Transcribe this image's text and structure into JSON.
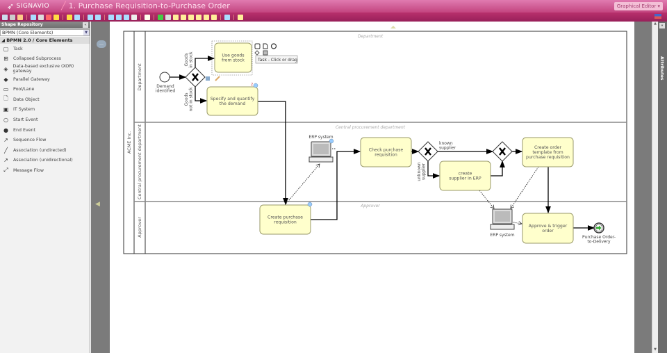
{
  "app": {
    "brand": "SIGNAVIO",
    "document_title": "1. Purchase Requisition-to-Purchase Order",
    "editor_mode": "Graphical Editor"
  },
  "toolbar": {
    "icons": [
      "save-icon",
      "print-icon",
      "cut-icon",
      "copy-icon",
      "paste-icon",
      "delete-icon",
      "undo-icon",
      "redo-icon",
      "align-icon",
      "layout-icon",
      "zoom-in-icon",
      "zoom-out-icon",
      "zoom-fit-icon",
      "zoom-page-icon",
      "text-format-icon",
      "comment-icon",
      "validate-icon",
      "attachment-icon",
      "export-icon",
      "import-icon",
      "share-icon",
      "publish-icon",
      "simulate-icon",
      "layer-icon",
      "mail-icon",
      "help-icon"
    ],
    "accent": "#b8306c"
  },
  "repository": {
    "title": "Shape Repository",
    "selected_set": "BPMN (Core Elements)",
    "group": "BPMN 2.0 / Core Elements",
    "items": [
      {
        "label": "Task",
        "icon": "▢"
      },
      {
        "label": "Collapsed Subprocess",
        "icon": "⊞"
      },
      {
        "label": "Data-based exclusive (XOR) gateway",
        "icon": "◈"
      },
      {
        "label": "Parallel Gateway",
        "icon": "◆"
      },
      {
        "label": "Pool/Lane",
        "icon": "▭"
      },
      {
        "label": "Data Object",
        "icon": "🗋"
      },
      {
        "label": "IT System",
        "icon": "▣"
      },
      {
        "label": "Start Event",
        "icon": "○"
      },
      {
        "label": "End Event",
        "icon": "●"
      },
      {
        "label": "Sequence Flow",
        "icon": "↗"
      },
      {
        "label": "Association (undirected)",
        "icon": "╱"
      },
      {
        "label": "Association (unidirectional)",
        "icon": "↗"
      },
      {
        "label": "Message Flow",
        "icon": "⤢"
      }
    ]
  },
  "attributes": {
    "label": "Attributes"
  },
  "diagram": {
    "pool": "ACME Inc.",
    "lanes": [
      "Department",
      "Central procurement department",
      "Approver"
    ],
    "start_event": [
      "Demand",
      "identified"
    ],
    "end_event": [
      "Purchase Order-",
      "to-Delivery"
    ],
    "tasks": {
      "use_goods": [
        "Use goods",
        "from stock"
      ],
      "specify": [
        "Specify and quantify",
        "the demand"
      ],
      "create_req": [
        "Create purchase",
        "requisition"
      ],
      "check_req": [
        "Check purchase",
        "requisition"
      ],
      "create_supplier": [
        "create",
        "supplier in ERP"
      ],
      "create_template": [
        "Create order",
        "template from",
        "purchase requisition"
      ],
      "approve": [
        "Approve & trigger",
        "order"
      ]
    },
    "gateway_labels": {
      "in_stock": [
        "Goods",
        "in stock"
      ],
      "not_in_stock": [
        "Goods",
        "not in stock"
      ],
      "known": [
        "known",
        "supplier"
      ],
      "unknown": [
        "unknown",
        "supplier"
      ]
    },
    "it_system": "ERP system",
    "tooltip": "Task - Click or drag",
    "comment_count": "2"
  }
}
